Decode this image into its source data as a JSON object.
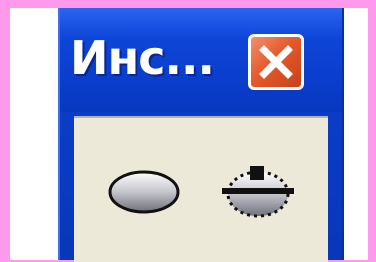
{
  "window": {
    "title": "Инс...",
    "close_label": "×"
  },
  "tools": [
    {
      "name": "ellipse-tool",
      "icon": "ellipse-icon"
    },
    {
      "name": "ellipse-selection-tool",
      "icon": "ellipse-selection-icon"
    }
  ]
}
